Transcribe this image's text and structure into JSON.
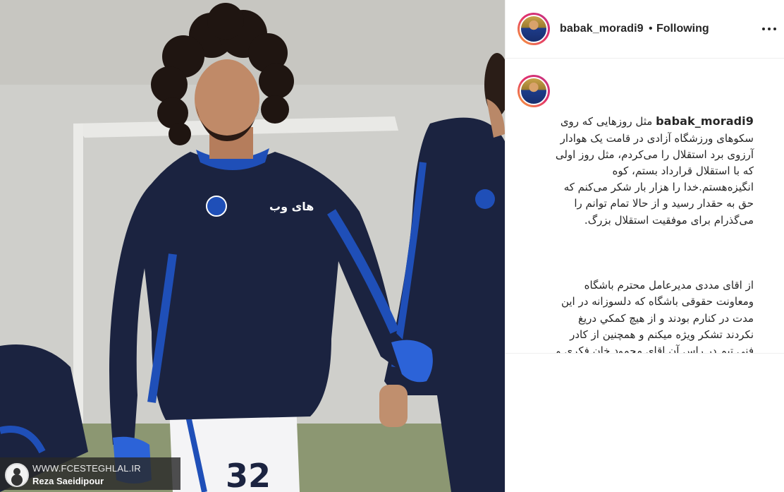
{
  "photo": {
    "alt": "",
    "watermark_site": "WWW.FCESTEGHLAL.IR",
    "watermark_credit": "Reza Saeidipour",
    "shirt_sponsor": "های وب",
    "shorts_number": "32"
  },
  "header": {
    "username": "babak_moradi9",
    "separator": "•",
    "follow_status": "Following",
    "more_icon": "more-horizontal-icon"
  },
  "post": {
    "author": "babak_moradi9",
    "caption_p1": "مثل روزهایی که روی سکوهای ورزشگاه آزادی در قامت یک هوادار آرزوی برد استقلال را می‌کردم، مثل روز اولی که با استقلال قرارداد بستم، کوه انگیزه‌هستم.خدا را هزار بار شکر می‌کنم که حق به حقدار رسید و از حالا تمام توانم را می‌گذرام برای موفقیت استقلال بزرگ.",
    "caption_p2": "از اقای مددی مدیرعامل محترم باشگاه ومعاونت حقوقی باشگاه که دلسوزانه در این مدت در کنارم بودند و از هیچ کمکي دریغ نکردند تشکر ویژه میکنم و همچنین از کادر فنی تیم در راس آن اقای محمود خان فکری و همه ی هم تیمی هام بابت انگیزه و انرژی که به من دادن سپاس گزارم و از زحمات اقای دکتر سلیمانی وکیل کار بلد و توانمند هم کمال تشکر رو دارم به امید اولین دیدار من و شما هواداران"
  },
  "colors": {
    "kit_navy": "#1b2340",
    "kit_blue": "#1f4fb8",
    "story_ring_start": "#f9a53a",
    "story_ring_end": "#c13584"
  }
}
